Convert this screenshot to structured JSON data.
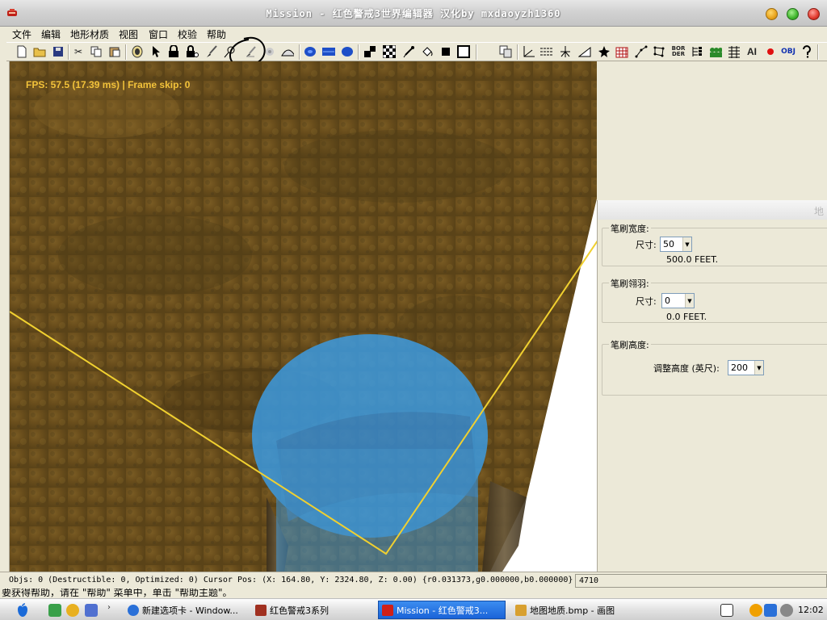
{
  "window": {
    "title": "Mission - 红色警戒3世界编辑器 汉化by mxdaoyzh1360"
  },
  "menu": {
    "items": [
      "文件",
      "编辑",
      "地形材质",
      "视图",
      "窗口",
      "校验",
      "帮助"
    ]
  },
  "toolbar": {
    "text_icons": {
      "border": "BOR\nDER",
      "ai": "AI",
      "obj": "OBJ"
    }
  },
  "viewport": {
    "fps_text": "FPS: 57.5 (17.39 ms) | Frame skip: 0",
    "colors": {
      "terrain": "#6e5420",
      "boundary": "#f0d030",
      "brush": "#3a9de8"
    }
  },
  "panel": {
    "title": "地",
    "brush_width": {
      "label": "笔刷宽度:",
      "size_label": "尺寸:",
      "value": "50",
      "feet": "500.0 FEET."
    },
    "brush_feather": {
      "label": "笔刷翎羽:",
      "size_label": "尺寸:",
      "value": "0",
      "feet": "0.0 FEET."
    },
    "brush_height": {
      "label": "笔刷高度:",
      "adjust_label": "调整高度 (英尺):",
      "value": "200"
    }
  },
  "status": {
    "text": "Objs: 0 (Destructible: 0, Optimized: 0) Cursor Pos: (X: 164.80, Y: 2324.80, Z: 0.00) {r0.031373,g0.000000,b0.000000}",
    "count": "4710"
  },
  "hint": {
    "text": "要获得帮助，请在 \"帮助\" 菜单中，单击 \"帮助主题\"。"
  },
  "taskbar": {
    "tasks": [
      "新建选项卡 - Window...",
      "红色警戒3系列",
      "Mission - 红色警戒3...",
      "地图地质.bmp - 画图"
    ],
    "clock": "12:02"
  }
}
